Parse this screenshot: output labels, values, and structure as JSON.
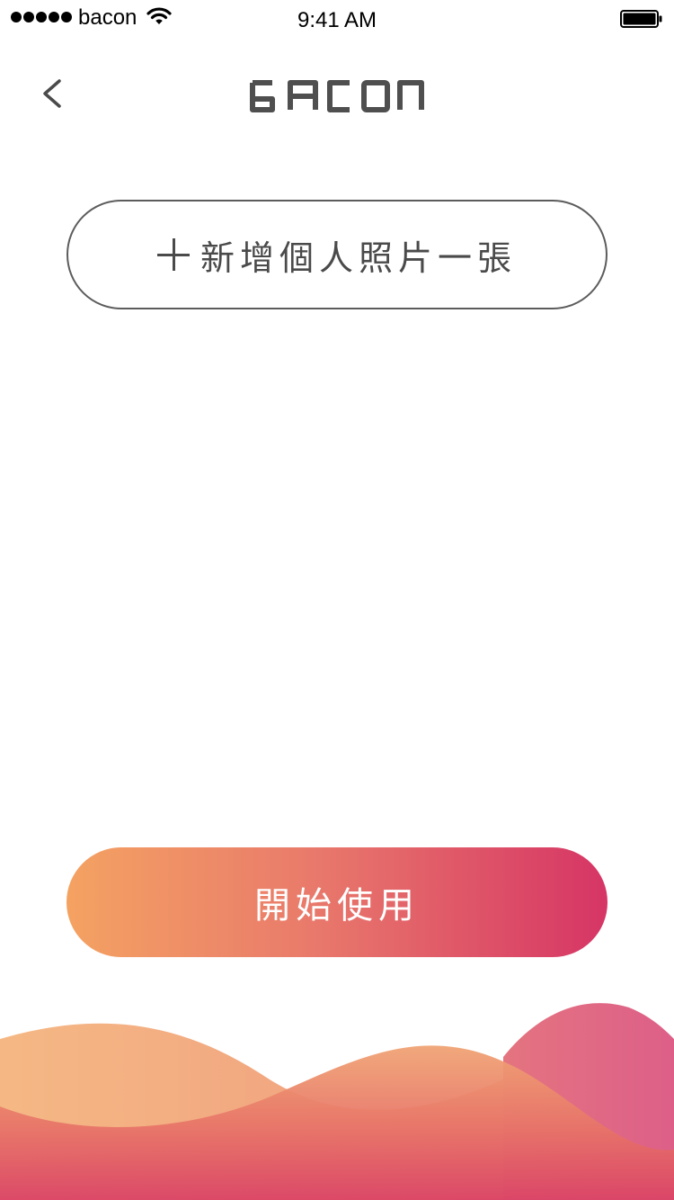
{
  "status_bar": {
    "carrier": "bacon",
    "time": "9:41 AM",
    "signal_icon": "signal-dots-icon",
    "wifi_icon": "wifi-icon",
    "battery_icon": "battery-icon"
  },
  "nav": {
    "back_icon": "chevron-left-icon",
    "logo_text": "BACON"
  },
  "add_photo_button": {
    "icon": "plus-icon",
    "label": "新增個人照片一張"
  },
  "start_button": {
    "label": "開始使用"
  },
  "colors": {
    "gradient_start": "#f4a262",
    "gradient_end": "#d63565",
    "outline": "#5c5c5c",
    "text_dark": "#4a4a4a"
  }
}
